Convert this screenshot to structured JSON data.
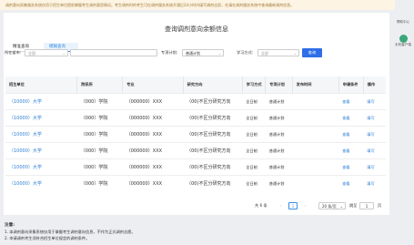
{
  "notice": "调剂意向采集服务系统仅用于招生单位提前掌握考生调剂意愿情况。考生调剂时的考生可在调剂服务系统开通后24小时内填写调剂志愿，在请在调剂服务系统中查询最新调剂信息。",
  "page_title": "查询调剂意向余额信息",
  "tabs": [
    "精准查询",
    "模糊查询"
  ],
  "filters": {
    "province_label": "所在省市:",
    "province_value": "全国",
    "school_value": "",
    "plan_label": "专项计划:",
    "plan_value": "普通计划",
    "mode_label": "学习方式:",
    "mode_value": "全部",
    "query_button": "查询"
  },
  "table": {
    "headers": [
      "招生单位",
      "院系所",
      "专业",
      "研究方向",
      "学习方式",
      "专项计划",
      "发布时间",
      "申请条件",
      "操作"
    ],
    "rows": [
      {
        "school": "（10000）大学",
        "dept": "（000）学院",
        "major": "（000000）XXX",
        "dir": "（00)不区分研究方向",
        "mode": "全日制",
        "plan": "普通计划",
        "time": "",
        "cond": "查看",
        "op": "填写"
      },
      {
        "school": "（10000）大学",
        "dept": "（000）学院",
        "major": "（000000）XXX",
        "dir": "（00)不区分研究方向",
        "mode": "全日制",
        "plan": "普通计划",
        "time": "",
        "cond": "查看",
        "op": "填写"
      },
      {
        "school": "（10000）大学",
        "dept": "（000）学院",
        "major": "（000000）XXX",
        "dir": "（00)不区分研究方向",
        "mode": "全日制",
        "plan": "普通计划",
        "time": "",
        "cond": "查看",
        "op": "填写"
      },
      {
        "school": "（10000）大学",
        "dept": "（000）学院",
        "major": "（000000）XXX",
        "dir": "（00)不区分研究方向",
        "mode": "全日制",
        "plan": "普通计划",
        "time": "",
        "cond": "查看",
        "op": "填写"
      },
      {
        "school": "（10000）大学",
        "dept": "（000）学院",
        "major": "（000000）XXX",
        "dir": "（00)不区分研究方向",
        "mode": "全日制",
        "plan": "普通计划",
        "time": "",
        "cond": "查看",
        "op": "填写"
      },
      {
        "school": "（10000）大学",
        "dept": "（000）学院",
        "major": "（000000）XXX",
        "dir": "（00)不区分研究方向",
        "mode": "全日制",
        "plan": "普通计划",
        "time": "",
        "cond": "查看",
        "op": "填写"
      }
    ]
  },
  "pager": {
    "total": "共 6 条",
    "prev": "‹",
    "current": "1",
    "next": "›",
    "page_size": "20 条/页",
    "goto_label": "跳至",
    "goto_value": "1",
    "goto_suffix": "页"
  },
  "notes": {
    "title": "注意:",
    "line1": "1. 本调剂意向采集系统仅用于掌握考生调剂意向信息，不作为正式调剂志愿。",
    "line2": "2. 申请调剂考生须符合招生单位规定的调剂条件。"
  },
  "side": {
    "help_label": "帮助中心",
    "help_sub": "中心",
    "app_label": "手机客户端",
    "app_sub": "客户端"
  }
}
